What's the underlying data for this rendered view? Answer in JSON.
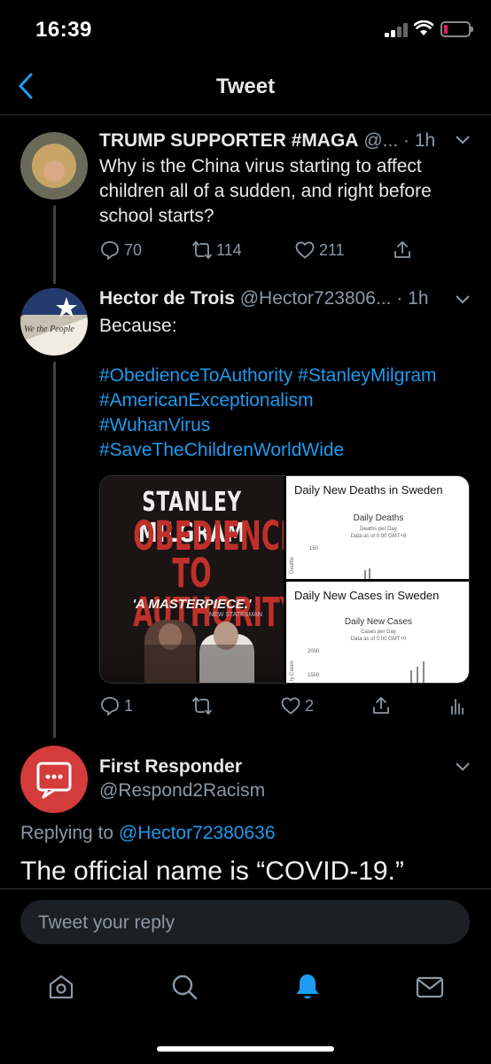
{
  "status_bar": {
    "time": "16:39",
    "battery_color": "#e0245e"
  },
  "nav": {
    "title": "Tweet",
    "back_icon": "chevron-left-icon"
  },
  "tweets": [
    {
      "name": "TRUMP SUPPORTER #MAGA",
      "handle": "@...",
      "time": "· 1h",
      "text": "Why is the China virus starting to affect children all of a sudden, and right before school starts?",
      "replies": "70",
      "retweets": "114",
      "likes": "211"
    },
    {
      "name": "Hector de Trois",
      "handle": "@Hector723806...",
      "time": "· 1h",
      "text": "Because:",
      "hashtags": [
        "#ObedienceToAuthority #StanleyMilgram",
        "#AmericanExceptionalism",
        "#WuhanVirus",
        "#SaveTheChildrenWorldWide"
      ],
      "replies": "1",
      "retweets": "",
      "likes": "2",
      "media": {
        "book": {
          "author": "STANLEY MILGRAM",
          "title_line1": "OBEDIENCE",
          "title_line2": "TO AUTHORITY",
          "blurb": "'A MASTERPIECE.'",
          "blurb_source": "NEW STATESMAN"
        },
        "deaths_panel": {
          "header": "Daily New Deaths in Sweden",
          "chart_title": "Daily Deaths",
          "subtitle_1": "Deaths per Day",
          "subtitle_2": "Data as of 0:00 GMT+8",
          "tick": "150",
          "axis": "Deaths"
        },
        "cases_panel": {
          "header": "Daily New Cases in Sweden",
          "chart_title": "Daily New Cases",
          "subtitle_1": "Cases per Day",
          "subtitle_2": "Data as of 0:00 GMT+0",
          "tick_1": "2000",
          "tick_2": "1500",
          "axis": "ly Cases"
        }
      }
    }
  ],
  "reply": {
    "name": "First Responder",
    "handle": "@Respond2Racism",
    "replying_prefix": "Replying to",
    "replying_to": "@Hector72380636",
    "text": "The official name is “COVID-19.”"
  },
  "composer": {
    "placeholder": "Tweet your reply"
  },
  "tabs": [
    "home-icon",
    "search-icon",
    "notifications-icon",
    "messages-icon"
  ],
  "colors": {
    "accent": "#1d9bf0",
    "background": "#000000",
    "secondary_text": "#8b98a5"
  }
}
